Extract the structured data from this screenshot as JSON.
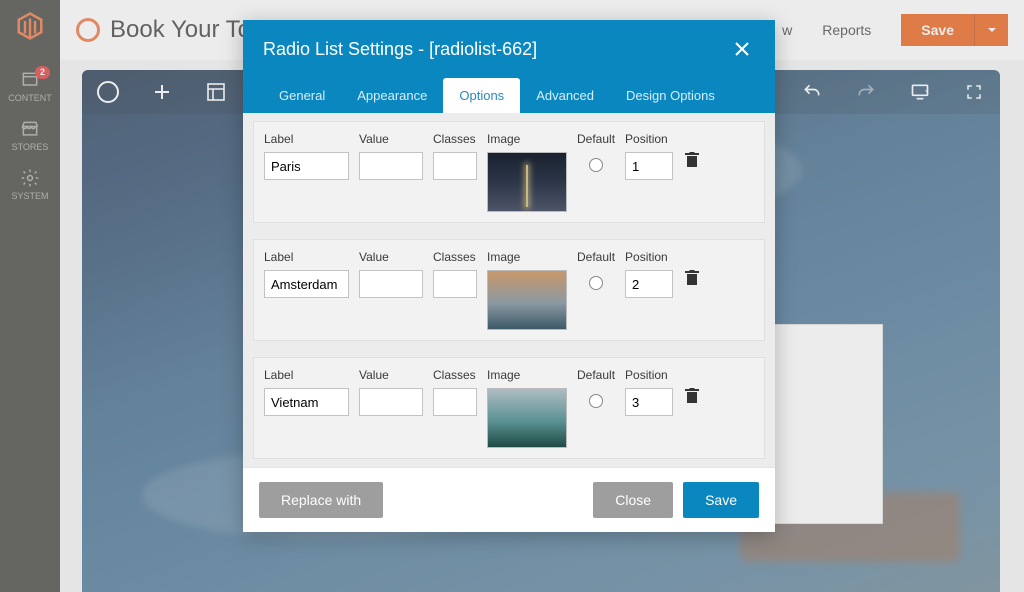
{
  "admin": {
    "nav": {
      "content": "CONTENT",
      "content_badge": "2",
      "stores": "STORES",
      "system": "SYSTEM"
    }
  },
  "topbar": {
    "title": "Book Your To",
    "menu_w": "w",
    "menu_reports": "Reports",
    "save": "Save"
  },
  "modal": {
    "title": "Radio List Settings - [radiolist-662]",
    "tabs": {
      "general": "General",
      "appearance": "Appearance",
      "options": "Options",
      "advanced": "Advanced",
      "design": "Design Options"
    },
    "headers": {
      "label": "Label",
      "value": "Value",
      "classes": "Classes",
      "image": "Image",
      "default": "Default",
      "position": "Position"
    },
    "rows": [
      {
        "label": "Paris",
        "value": "",
        "classes": "",
        "position": "1"
      },
      {
        "label": "Amsterdam",
        "value": "",
        "classes": "",
        "position": "2"
      },
      {
        "label": "Vietnam",
        "value": "",
        "classes": "",
        "position": "3"
      }
    ],
    "footer": {
      "replace": "Replace with",
      "close": "Close",
      "save": "Save"
    }
  },
  "colors": {
    "accent": "#0b87bf",
    "orange": "#eb5202"
  }
}
